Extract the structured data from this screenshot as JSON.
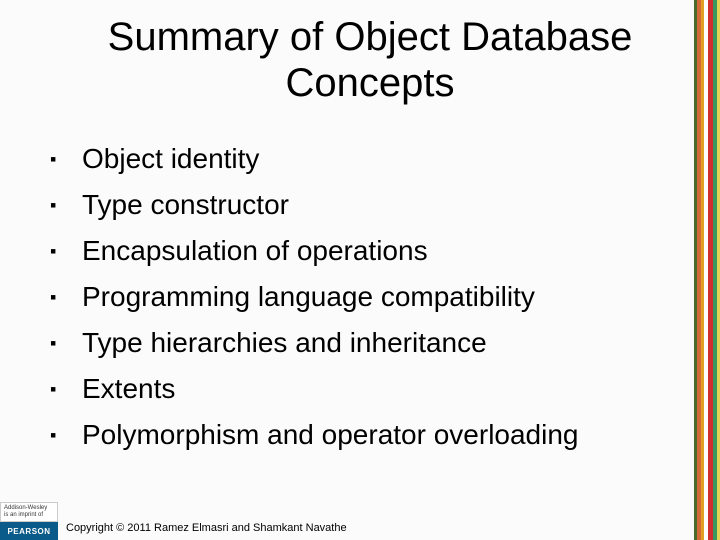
{
  "title": "Summary of Object Database Concepts",
  "bullets": [
    "Object identity",
    "Type constructor",
    "Encapsulation of operations",
    "Programming language compatibility",
    "Type hierarchies and inheritance",
    "Extents",
    "Polymorphism and operator overloading"
  ],
  "logo": {
    "line1": "Addison-Wesley",
    "line2": "is an imprint of",
    "brand": "PEARSON"
  },
  "copyright": "Copyright © 2011 Ramez Elmasri and Shamkant Navathe"
}
